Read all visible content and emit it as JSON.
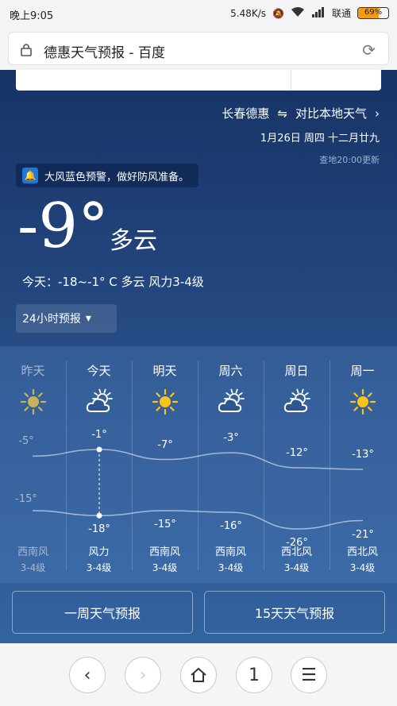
{
  "status": {
    "time": "晚上9:05",
    "speed": "5.48K/s",
    "carrier": "联通",
    "battery": "69%",
    "battery_level": 0.69
  },
  "browser": {
    "title": "德惠天气预报 - 百度"
  },
  "weather": {
    "location": "长春德惠",
    "compare": "对比本地天气",
    "date": "1月26日  周四  十二月廿九",
    "update": "查地20:00更新",
    "warning": "大风蓝色预警，做好防风准备。",
    "current_temp": "-9°",
    "condition": "多云",
    "today": "今天：-18~-1° C  多云  风力3-4级",
    "dropdown": "24小时预报"
  },
  "forecast": {
    "days": [
      {
        "day": "昨天",
        "icon": "sun-icon",
        "high": "-5°",
        "low": "-15°",
        "wind": "西南风",
        "level": "3-4级",
        "dim": true
      },
      {
        "day": "今天",
        "icon": "partly-cloudy-icon",
        "high": "-1°",
        "low": "-18°",
        "wind": "风力",
        "level": "3-4级",
        "dim": false
      },
      {
        "day": "明天",
        "icon": "sun-icon",
        "high": "-7°",
        "low": "-15°",
        "wind": "西南风",
        "level": "3-4级",
        "dim": false
      },
      {
        "day": "周六",
        "icon": "partly-cloudy-icon",
        "high": "-3°",
        "low": "-16°",
        "wind": "西南风",
        "level": "3-4级",
        "dim": false
      },
      {
        "day": "周日",
        "icon": "partly-cloudy-icon",
        "high": "-12°",
        "low": "-26°",
        "wind": "西北风",
        "level": "3-4级",
        "dim": false
      },
      {
        "day": "周一",
        "icon": "sun-icon",
        "high": "-13°",
        "low": "-21°",
        "wind": "西北风",
        "level": "3-4级",
        "dim": false
      }
    ]
  },
  "buttons": {
    "week": "一周天气预报",
    "fifteen": "15天天气预报"
  },
  "nav": {
    "tabs": "1"
  }
}
